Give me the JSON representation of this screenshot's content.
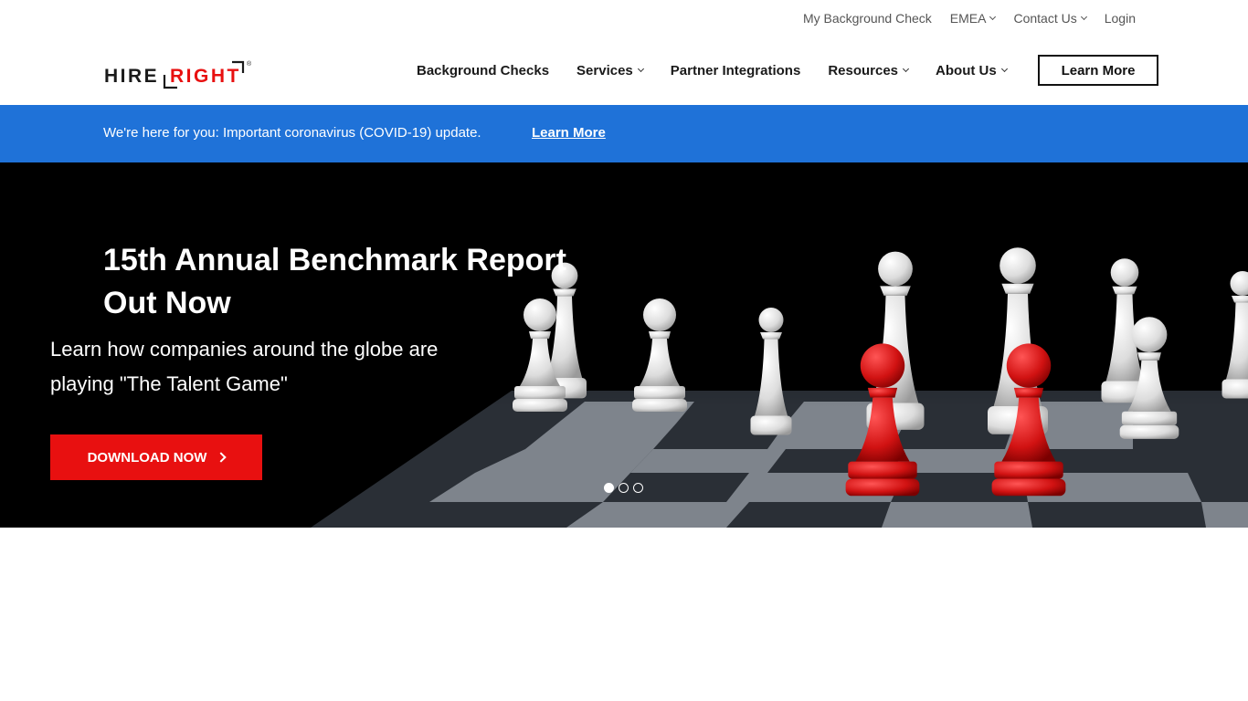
{
  "utility": {
    "links": [
      {
        "label": "My Background Check",
        "dropdown": false
      },
      {
        "label": "EMEA",
        "dropdown": true
      },
      {
        "label": "Contact Us",
        "dropdown": true
      },
      {
        "label": "Login",
        "dropdown": false
      }
    ]
  },
  "brand": {
    "logo_text_left": "HIRE",
    "logo_text_right": "RIGHT",
    "logo_mark": "®",
    "accent": "#e81010"
  },
  "nav": {
    "items": [
      {
        "label": "Background Checks",
        "dropdown": false
      },
      {
        "label": "Services",
        "dropdown": true
      },
      {
        "label": "Partner Integrations",
        "dropdown": false
      },
      {
        "label": "Resources",
        "dropdown": true
      },
      {
        "label": "About Us",
        "dropdown": true
      }
    ],
    "cta_label": "Learn More"
  },
  "alert": {
    "text": "We're here for you: Important coronavirus (COVID-19) update.",
    "link_label": "Learn More",
    "background": "#1f72d8"
  },
  "hero": {
    "title_line1": "15th Annual Benchmark Report",
    "title_line2": "Out Now",
    "subtitle_line1": "Learn how companies around the globe are",
    "subtitle_line2": "playing \"The Talent Game\"",
    "button_label": "DOWNLOAD NOW",
    "button_color": "#e81010",
    "image_icon": "chess-board-image",
    "slides_total": 3,
    "active_slide": 1
  }
}
